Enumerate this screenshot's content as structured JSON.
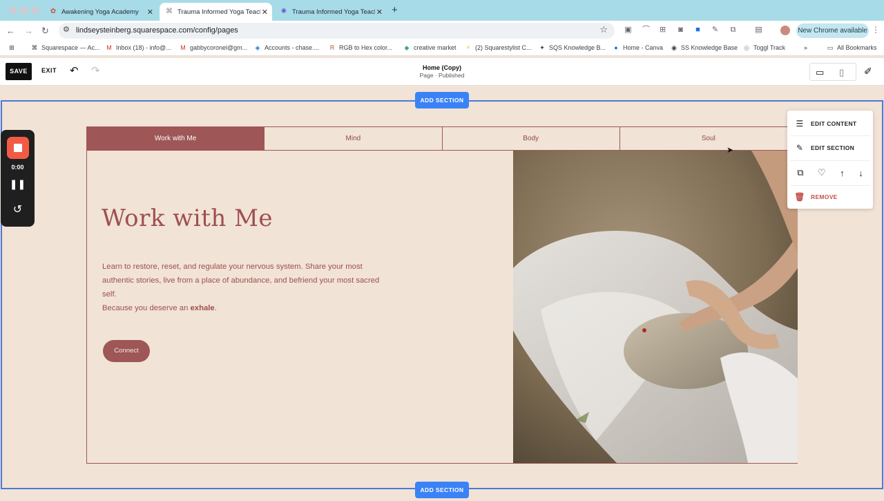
{
  "browser": {
    "tabs": [
      {
        "title": "Awakening Yoga Academy",
        "favicon": "yoga-favicon-icon"
      },
      {
        "title": "Trauma Informed Yoga Teache",
        "favicon": "squarespace-favicon-icon"
      },
      {
        "title": "Trauma Informed Yoga Teache",
        "favicon": "star-favicon-icon"
      }
    ],
    "url": "lindseysteinberg.squarespace.com/config/pages",
    "update_label": "New Chrome available",
    "bookmarks": [
      "Squarespace — Ac...",
      "Inbox (18) - info@...",
      "gabbycoronel@gm...",
      "Accounts - chase....",
      "RGB to Hex color...",
      "creative market",
      "(2) Squarestylist C...",
      "SQS Knowledge B...",
      "Home - Canva",
      "SS Knowledge Base",
      "Toggl Track"
    ],
    "all_bookmarks": "All Bookmarks"
  },
  "editor": {
    "save": "SAVE",
    "exit": "EXIT",
    "page_title": "Home (Copy)",
    "page_status": "Page · Published"
  },
  "add_section": "ADD SECTION",
  "tabs_nav": [
    "Work with Me",
    "Mind",
    "Body",
    "Soul"
  ],
  "content": {
    "heading": "Work with Me",
    "paragraph": "Learn to restore, reset, and regulate your nervous system. Share your most authentic stories, live from a place of abundance, and befriend your most sacred self.",
    "tagline_prefix": "Because you deserve an ",
    "tagline_bold": "exhale",
    "tagline_suffix": ".",
    "button": "Connect"
  },
  "recorder": {
    "time": "0:00"
  },
  "context_menu": {
    "edit_content": "EDIT CONTENT",
    "edit_section": "EDIT SECTION",
    "remove": "REMOVE"
  },
  "colors": {
    "accent": "#9e5656",
    "background": "#f1e3d6",
    "editor_blue": "#3b82f6"
  }
}
